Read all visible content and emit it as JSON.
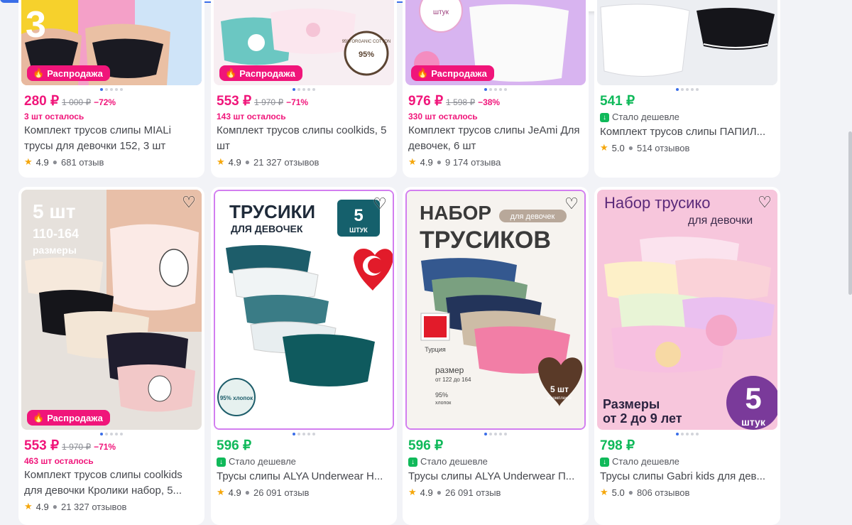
{
  "colors": {
    "accent": "#3a6ee8",
    "sale": "#f0157a",
    "green": "#10b95a"
  },
  "icons": {
    "favorite": "heart-outline-icon",
    "sale": "fire-icon",
    "rating": "star-icon",
    "reviews": "chat-bubble-icon",
    "cheaper": "arrow-down-icon"
  },
  "products": [
    {
      "price": "280 ₽",
      "old_price": "1 000 ₽",
      "discount": "−72%",
      "stock": "3 шт осталось",
      "title": "Комплект трусов слипы MIALi трусы для девочки 152, 3 шт",
      "rating": "4.9",
      "reviews": "681 отзыв",
      "badge": "Распродажа",
      "image_text": "3"
    },
    {
      "price": "553 ₽",
      "old_price": "1 970 ₽",
      "discount": "−71%",
      "stock": "143 шт осталось",
      "title": "Комплект трусов слипы coolkids, 5 шт",
      "rating": "4.9",
      "reviews": "21 327 отзывов",
      "badge": "Распродажа",
      "image_text": "95% ORGANIC COTTON"
    },
    {
      "price": "976 ₽",
      "old_price": "1 598 ₽",
      "discount": "−38%",
      "stock": "330 шт осталось",
      "title": "Комплект трусов слипы JeAmi Для девочек, 6 шт",
      "rating": "4.9",
      "reviews": "9 174 отзыва",
      "badge": "Распродажа",
      "image_text": "штук"
    },
    {
      "price": "541 ₽",
      "cheaper": "Стало дешевле",
      "title": "Комплект трусов слипы ПАПИЛ...",
      "rating": "5.0",
      "reviews": "514 отзывов"
    },
    {
      "price": "553 ₽",
      "old_price": "1 970 ₽",
      "discount": "−71%",
      "stock": "463 шт осталось",
      "title": "Комплект трусов слипы coolkids для девочки Кролики набор, 5...",
      "rating": "4.9",
      "reviews": "21 327 отзывов",
      "badge": "Распродажа",
      "image_line1": "5 шт",
      "image_line2": "110-164",
      "image_line3": "размеры"
    },
    {
      "price": "596 ₽",
      "cheaper": "Стало дешевле",
      "title": "Трусы слипы ALYA Underwear Н...",
      "rating": "4.9",
      "reviews": "26 091 отзыв",
      "image_line1": "ТРУСИКИ",
      "image_line2": "ДЛЯ ДЕВОЧЕК",
      "image_num": "5",
      "image_unit": "ШТУК",
      "image_cotton": "95% хлопок"
    },
    {
      "price": "596 ₽",
      "cheaper": "Стало дешевле",
      "title": "Трусы слипы ALYA Underwear П...",
      "rating": "4.9",
      "reviews": "26 091 отзыв",
      "image_line1": "НАБОР",
      "image_tag": "для девочек",
      "image_line2": "ТРУСИКОВ",
      "image_country": "Турция",
      "image_size1": "размер",
      "image_size2": "от 122 до 164",
      "image_cotton1": "95%",
      "image_cotton2": "хлопок",
      "image_badge1": "5 шт",
      "image_badge2": "в комплекте"
    },
    {
      "price": "798 ₽",
      "cheaper": "Стало дешевле",
      "title": "Трусы слипы Gabri kids для дев...",
      "rating": "5.0",
      "reviews": "806 отзывов",
      "image_line1": "Набор трусико",
      "image_line2": "для девочки",
      "image_line3": "Размеры",
      "image_line4": "от 2 до 9 лет",
      "image_num": "5",
      "image_unit": "штук"
    }
  ]
}
